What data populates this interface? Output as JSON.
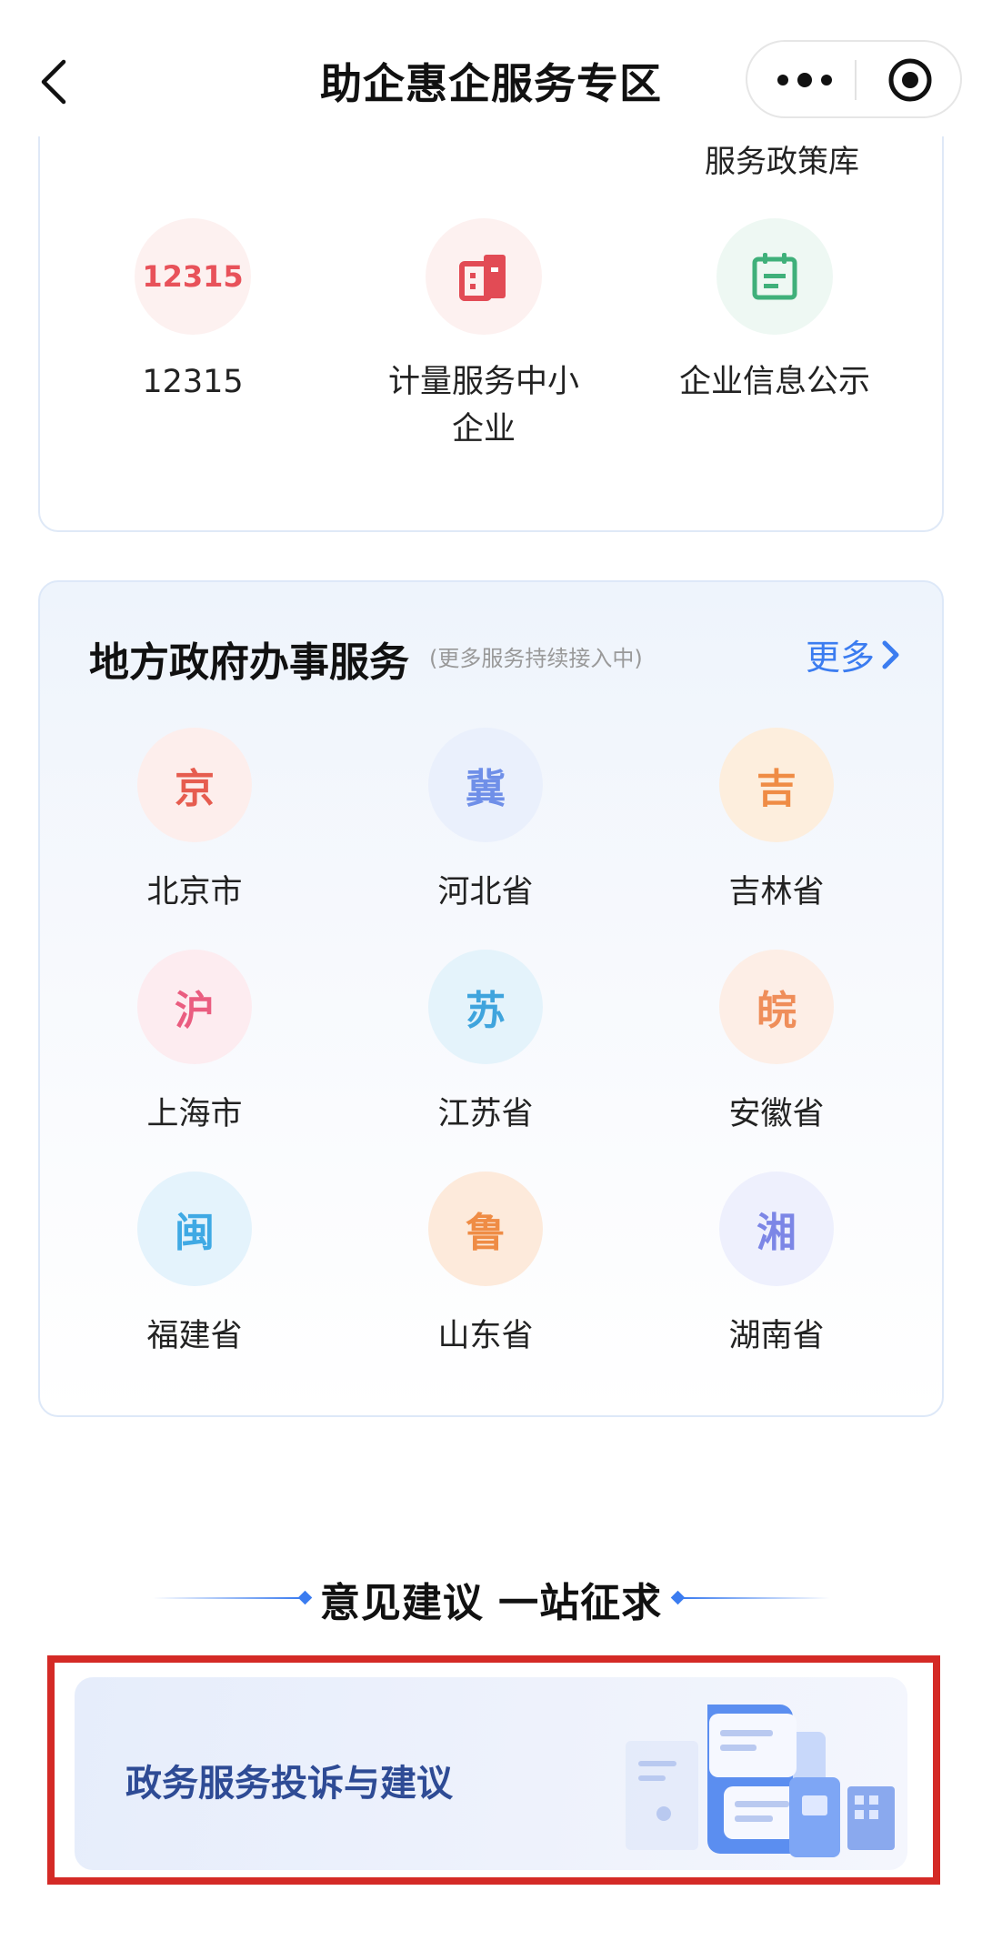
{
  "nav": {
    "title": "助企惠企服务专区",
    "icons": [
      "chevron-left-icon",
      "more-dots-icon",
      "target-close-icon"
    ]
  },
  "top_card": {
    "cut_label": "服务政策库",
    "items": [
      {
        "icon_text": "12315",
        "label": "12315",
        "icon": "12315-badge-icon"
      },
      {
        "label": "计量服务中小企业",
        "icon": "metrics-building-icon"
      },
      {
        "label": "企业信息公示",
        "icon": "info-calendar-icon"
      }
    ]
  },
  "local_gov": {
    "title": "地方政府办事服务",
    "subtitle": "(更多服务持续接入中)",
    "more_label": "更多",
    "provinces": [
      {
        "abbr": "京",
        "name": "北京市",
        "color": "#e65c4f",
        "bg": "#fdeeec"
      },
      {
        "abbr": "冀",
        "name": "河北省",
        "color": "#6f8fe8",
        "bg": "#eaf0fc"
      },
      {
        "abbr": "吉",
        "name": "吉林省",
        "color": "#ef8c45",
        "bg": "#fdeedd"
      },
      {
        "abbr": "沪",
        "name": "上海市",
        "color": "#ea5d80",
        "bg": "#fdecf0"
      },
      {
        "abbr": "苏",
        "name": "江苏省",
        "color": "#3fa4dd",
        "bg": "#e4f3fb"
      },
      {
        "abbr": "皖",
        "name": "安徽省",
        "color": "#ef8e5a",
        "bg": "#fdeee6"
      },
      {
        "abbr": "闽",
        "name": "福建省",
        "color": "#3fa9e4",
        "bg": "#e4f3fc"
      },
      {
        "abbr": "鲁",
        "name": "山东省",
        "color": "#ef8c45",
        "bg": "#fdeadb"
      },
      {
        "abbr": "湘",
        "name": "湖南省",
        "color": "#7c86e6",
        "bg": "#eef0fd"
      }
    ]
  },
  "feedback": {
    "title": "意见建议 一站征求",
    "banner_label": "政务服务投诉与建议",
    "highlight_color": "#d42a26"
  }
}
